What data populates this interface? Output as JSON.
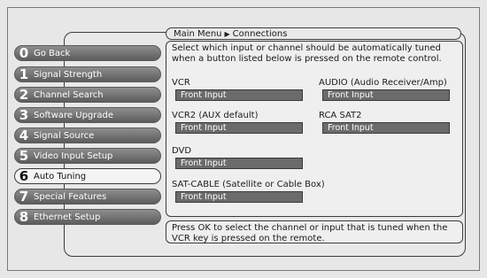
{
  "menu": [
    {
      "num": "0",
      "label": "Go Back",
      "active": false
    },
    {
      "num": "1",
      "label": "Signal Strength",
      "active": false
    },
    {
      "num": "2",
      "label": "Channel Search",
      "active": false
    },
    {
      "num": "3",
      "label": "Software Upgrade",
      "active": false
    },
    {
      "num": "4",
      "label": "Signal Source",
      "active": false
    },
    {
      "num": "5",
      "label": "Video Input Setup",
      "active": false
    },
    {
      "num": "6",
      "label": "Auto Tuning",
      "active": true
    },
    {
      "num": "7",
      "label": "Special Features",
      "active": false
    },
    {
      "num": "8",
      "label": "Ethernet Setup",
      "active": false
    }
  ],
  "breadcrumb": {
    "root": "Main Menu",
    "current": "Connections"
  },
  "instructions": "Select which input or channel should be automatically tuned when a button listed below is pressed on the remote control.",
  "fields": {
    "vcr": {
      "label": "VCR",
      "value": "Front Input"
    },
    "audio": {
      "label": "AUDIO (Audio Receiver/Amp)",
      "value": "Front Input"
    },
    "vcr2": {
      "label": "VCR2 (AUX default)",
      "value": "Front Input"
    },
    "rcasat2": {
      "label": "RCA SAT2",
      "value": "Front Input"
    },
    "dvd": {
      "label": "DVD",
      "value": "Front Input"
    },
    "satcable": {
      "label": "SAT-CABLE (Satellite or Cable Box)",
      "value": "Front Input"
    }
  },
  "help_text": "Press OK to select the channel or input that is tuned when the VCR key is pressed on the remote.",
  "colors": {
    "button": "#6e6e6e",
    "active_button": "#f4f4f4",
    "value_box": "#6b6b6b"
  }
}
